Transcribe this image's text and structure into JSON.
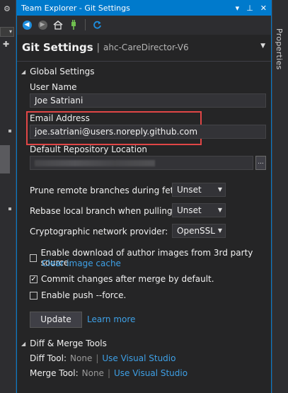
{
  "left_strip": {
    "gear_icon": "gear-icon"
  },
  "right_strip": {
    "label": "Properties"
  },
  "window": {
    "title": "Team Explorer - Git Settings",
    "controls": [
      "▾",
      "⊥",
      "✕"
    ]
  },
  "toolbar": {
    "icons": [
      "back-icon",
      "forward-icon",
      "home-icon",
      "connect-icon",
      "refresh-icon"
    ]
  },
  "page": {
    "title": "Git Settings",
    "separator": "|",
    "subtitle": "ahc-CareDirector-V6",
    "dropdown": "▼"
  },
  "global": {
    "header": "Global Settings",
    "user_name_label": "User Name",
    "user_name_value": "Joe Satriani",
    "email_label": "Email Address",
    "email_value": "joe.satriani@users.noreply.github.com",
    "repo_label": "Default Repository Location",
    "browse_label": "...",
    "prune_label": "Prune remote branches during fetch:",
    "prune_value": "Unset",
    "rebase_label": "Rebase local branch when pulling:",
    "rebase_value": "Unset",
    "crypto_label": "Cryptographic network provider:",
    "crypto_value": "OpenSSL",
    "author_images_label": "Enable download of author images from 3rd party source.",
    "author_images_checked": false,
    "clear_cache_link": "Clear image cache",
    "commit_merge_label": "Commit changes after merge by default.",
    "commit_merge_checked": true,
    "push_force_label": "Enable push --force.",
    "push_force_checked": false,
    "update_button": "Update",
    "learn_more": "Learn more"
  },
  "diff": {
    "header": "Diff & Merge Tools",
    "diff_label": "Diff Tool:",
    "diff_value": "None",
    "diff_link": "Use Visual Studio",
    "merge_label": "Merge Tool:",
    "merge_value": "None",
    "merge_link": "Use Visual Studio",
    "pipe": "|"
  },
  "colors": {
    "accent": "#007acc",
    "link": "#3ea0e6",
    "highlight": "#e04646",
    "background": "#252526"
  }
}
